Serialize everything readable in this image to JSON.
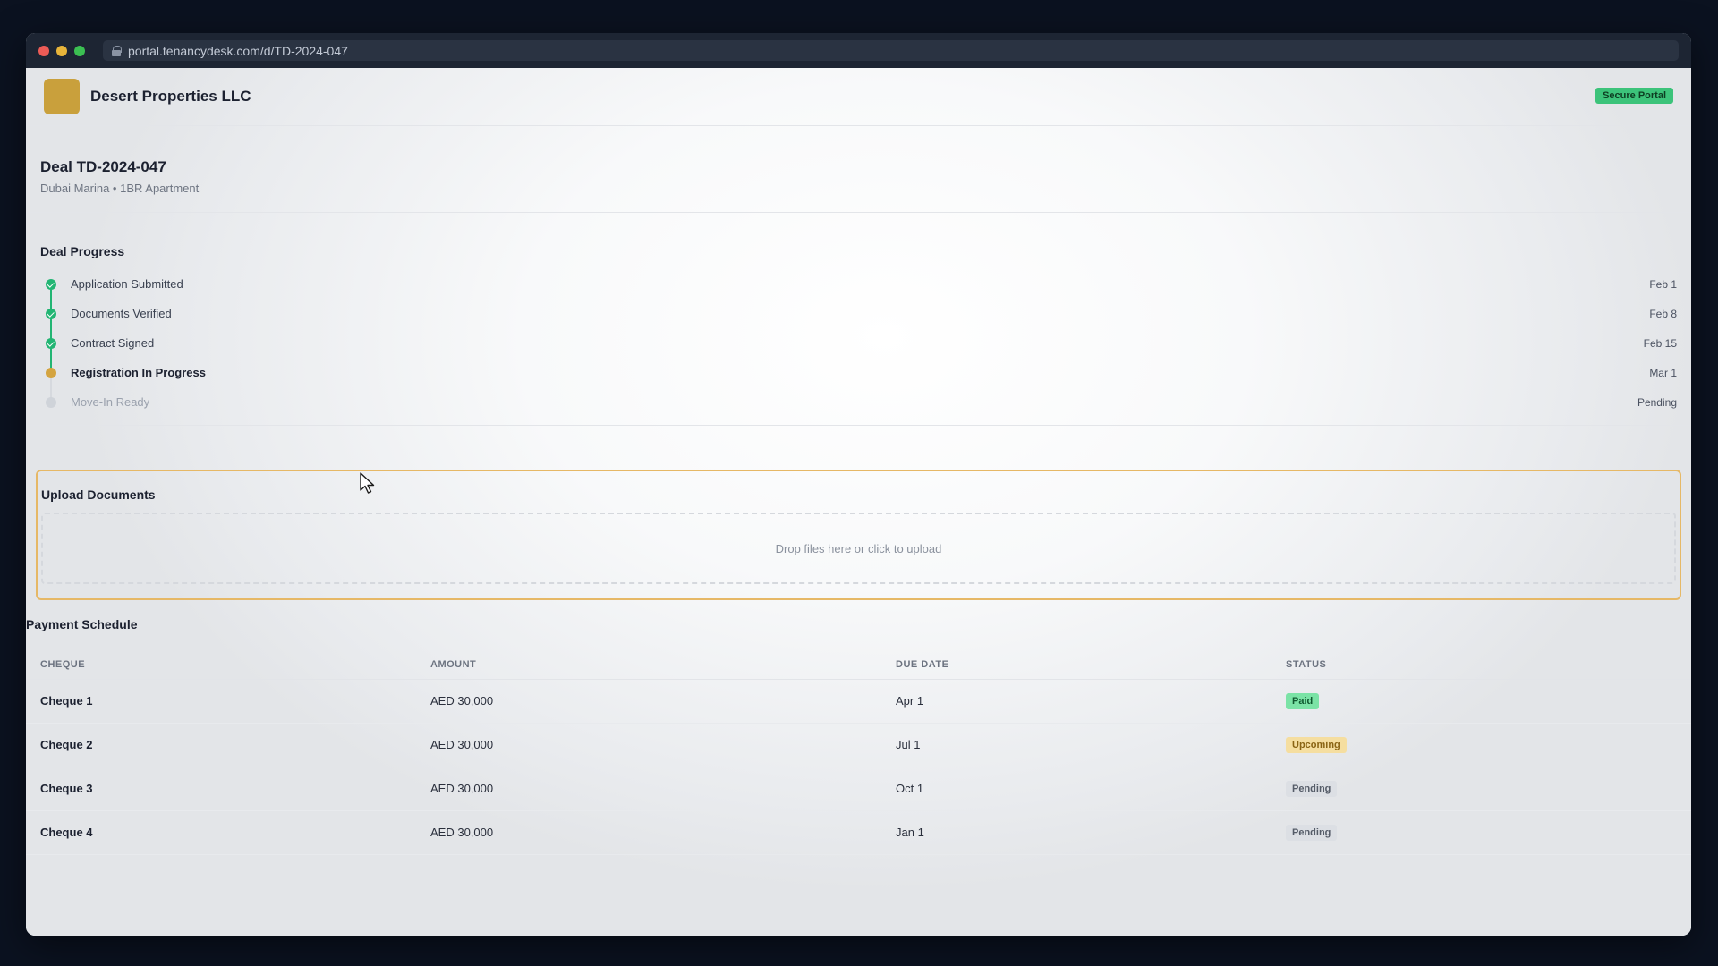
{
  "browser": {
    "url": "portal.tenancydesk.com/d/TD-2024-047"
  },
  "header": {
    "company_name": "Desert Properties LLC",
    "badge": "Secure Portal"
  },
  "deal": {
    "title": "Deal TD-2024-047",
    "subtitle": "Dubai Marina • 1BR Apartment"
  },
  "progress": {
    "title": "Deal Progress",
    "steps": [
      {
        "label": "Application Submitted",
        "date": "Feb 1",
        "state": "done"
      },
      {
        "label": "Documents Verified",
        "date": "Feb 8",
        "state": "done"
      },
      {
        "label": "Contract Signed",
        "date": "Feb 15",
        "state": "done"
      },
      {
        "label": "Registration In Progress",
        "date": "Mar 1",
        "state": "current"
      },
      {
        "label": "Move-In Ready",
        "date": "Pending",
        "state": "pending"
      }
    ]
  },
  "upload": {
    "title": "Upload Documents",
    "dropzone_text": "Drop files here or click to upload"
  },
  "payments": {
    "title": "Payment Schedule",
    "columns": [
      "CHEQUE",
      "AMOUNT",
      "DUE DATE",
      "STATUS"
    ],
    "rows": [
      {
        "cheque": "Cheque 1",
        "amount": "AED 30,000",
        "due": "Apr 1",
        "status": "Paid"
      },
      {
        "cheque": "Cheque 2",
        "amount": "AED 30,000",
        "due": "Jul 1",
        "status": "Upcoming"
      },
      {
        "cheque": "Cheque 3",
        "amount": "AED 30,000",
        "due": "Oct 1",
        "status": "Pending"
      },
      {
        "cheque": "Cheque 4",
        "amount": "AED 30,000",
        "due": "Jan 1",
        "status": "Pending"
      }
    ]
  },
  "colors": {
    "brand": "#c9a03c",
    "done": "#22b573",
    "current": "#d4a440",
    "upload_border": "#e6b866"
  }
}
